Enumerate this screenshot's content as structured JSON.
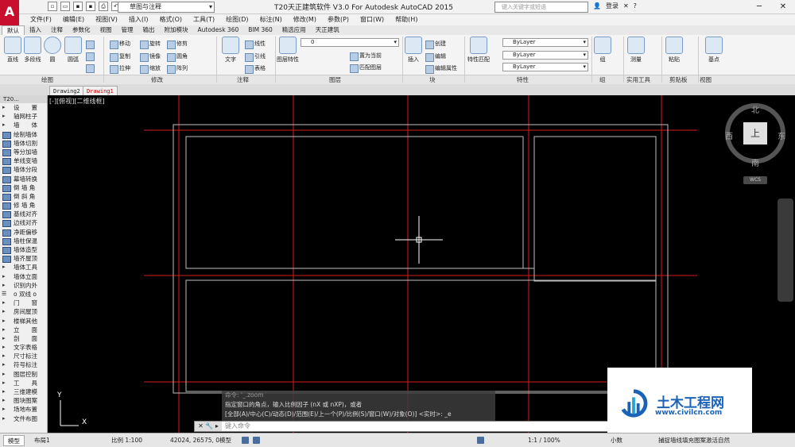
{
  "title": "T20天正建筑软件 V3.0 For Autodesk AutoCAD 2015",
  "workspace": "草图与注释",
  "search_placeholder": "键入关键字或短语",
  "login": "登录",
  "menu": [
    "文件(F)",
    "编辑(E)",
    "视图(V)",
    "插入(I)",
    "格式(O)",
    "工具(T)",
    "绘图(D)",
    "标注(N)",
    "修改(M)",
    "参数(P)",
    "窗口(W)",
    "帮助(H)"
  ],
  "ribbon_tabs": [
    "默认",
    "插入",
    "注释",
    "参数化",
    "视图",
    "管理",
    "输出",
    "附加模块",
    "Autodesk 360",
    "BIM 360",
    "精选应用",
    "天正建筑"
  ],
  "ribbon": {
    "draw": {
      "label": "绘图",
      "line": "直线",
      "polyline": "多段线",
      "circle": "圆",
      "arc": "圆弧"
    },
    "modify": {
      "label": "修改",
      "items": [
        "移动",
        "旋转",
        "修剪",
        "复制",
        "镜像",
        "圆角",
        "拉伸",
        "缩放",
        "阵列"
      ]
    },
    "annotation": {
      "label": "注释",
      "text": "文字",
      "linear": "线性",
      "leader": "引线",
      "table": "表格"
    },
    "layer": {
      "label": "图层",
      "props": "图层特性",
      "current": "0",
      "make_current": "置为当前",
      "match": "匹配图层"
    },
    "block": {
      "label": "块",
      "insert": "插入",
      "create": "创建",
      "edit": "编辑",
      "edit_attr": "编辑属性"
    },
    "properties": {
      "label": "特性",
      "match": "特性匹配",
      "bylayer1": "ByLayer",
      "bylayer2": "ByLayer",
      "bylayer3": "ByLayer"
    },
    "groups": {
      "label": "组",
      "group": "组"
    },
    "utilities": {
      "label": "实用工具",
      "measure": "测量"
    },
    "clipboard": {
      "label": "剪贴板",
      "paste": "粘贴"
    },
    "view": {
      "label": "视图",
      "base": "基点"
    }
  },
  "file_tabs": [
    "Drawing2",
    "Drawing1"
  ],
  "palette": {
    "header": "T20...",
    "items": [
      {
        "t": "设　　置",
        "k": "arrow"
      },
      {
        "t": "轴网柱子",
        "k": "arrow"
      },
      {
        "t": "墙　　体",
        "k": "arrow"
      },
      {
        "t": "绘制墙体",
        "k": "icon"
      },
      {
        "t": "墙体切割",
        "k": "icon"
      },
      {
        "t": "等分加墙",
        "k": "icon"
      },
      {
        "t": "单线变墙",
        "k": "icon"
      },
      {
        "t": "墙体分段",
        "k": "icon"
      },
      {
        "t": "幕墙转换",
        "k": "icon"
      },
      {
        "t": "倒 墙 角",
        "k": "icon"
      },
      {
        "t": "倒 斜 角",
        "k": "icon"
      },
      {
        "t": "修 墙 角",
        "k": "icon"
      },
      {
        "t": "基线对齐",
        "k": "icon"
      },
      {
        "t": "边线对齐",
        "k": "icon"
      },
      {
        "t": "净距偏移",
        "k": "icon"
      },
      {
        "t": "墙柱保温",
        "k": "icon"
      },
      {
        "t": "墙体造型",
        "k": "icon"
      },
      {
        "t": "墙齐屋顶",
        "k": "icon"
      },
      {
        "t": "墙体工具",
        "k": "arrow"
      },
      {
        "t": "墙体立面",
        "k": "arrow"
      },
      {
        "t": "识别内外",
        "k": "arrow"
      },
      {
        "t": "o 双线 o",
        "k": "sect"
      },
      {
        "t": "门　　窗",
        "k": "arrow"
      },
      {
        "t": "房间屋顶",
        "k": "arrow"
      },
      {
        "t": "楼梯其他",
        "k": "arrow"
      },
      {
        "t": "立　　面",
        "k": "arrow"
      },
      {
        "t": "剖　　面",
        "k": "arrow"
      },
      {
        "t": "文字表格",
        "k": "arrow"
      },
      {
        "t": "尺寸标注",
        "k": "arrow"
      },
      {
        "t": "符号标注",
        "k": "arrow"
      },
      {
        "t": "图层控制",
        "k": "arrow"
      },
      {
        "t": "工　　具",
        "k": "arrow"
      },
      {
        "t": "三维建模",
        "k": "arrow"
      },
      {
        "t": "图块图案",
        "k": "arrow"
      },
      {
        "t": "场地布置",
        "k": "arrow"
      },
      {
        "t": "文件布图",
        "k": "arrow"
      }
    ]
  },
  "viewport_label": "[-][俯视][二维线框]",
  "compass": {
    "n": "北",
    "s": "南",
    "e": "东",
    "w": "西",
    "face": "上",
    "wcs": "WCS"
  },
  "command": {
    "history": [
      "命令: '_.zoom",
      "指定窗口的角点，输入比例因子 (nX 或 nXP)，或者",
      "[全部(A)/中心(C)/动态(D)/范围(E)/上一个(P)/比例(S)/窗口(W)/对象(O)] <实时>: _e"
    ],
    "prompt": "键入命令"
  },
  "watermark": {
    "title": "土木工程网",
    "url": "www.civilcn.com"
  },
  "status": {
    "model_tab": "模型",
    "layout_tab": "布局1",
    "scale": "比例 1:100",
    "coords": "42024, 26575, 0",
    "mode": "模型",
    "annot_scale": "1:1 / 100%",
    "units": "小数",
    "tip": "捕捉墙线填充图案激活自然"
  },
  "colors": {
    "grid": "#d81b1b",
    "wall": "#bfbfbf",
    "crosshair": "#ffffff",
    "brand": "#1b63b8"
  }
}
